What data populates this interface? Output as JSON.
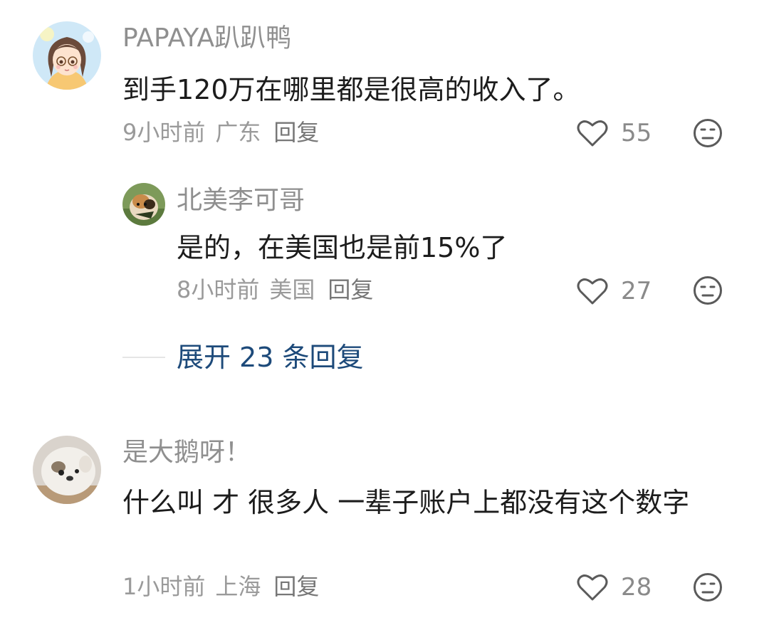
{
  "comments": [
    {
      "username": "PAPAYA趴趴鸭",
      "content": "到手120万在哪里都是很高的收入了。",
      "time": "9小时前",
      "location": "广东",
      "reply_label": "回复",
      "likes": "55",
      "avatar_icon": "anime-girl-avatar",
      "replies": [
        {
          "username": "北美李可哥",
          "content": "是的，在美国也是前15%了",
          "time": "8小时前",
          "location": "美国",
          "reply_label": "回复",
          "likes": "27",
          "avatar_icon": "hamster-avatar"
        }
      ],
      "expand_label": "展开 23 条回复"
    },
    {
      "username": "是大鹅呀！",
      "content": "什么叫 才 很多人 一辈子账户上都没有这个数字",
      "time": "1小时前",
      "location": "上海",
      "reply_label": "回复",
      "likes": "28",
      "avatar_icon": "puppy-avatar"
    }
  ],
  "colors": {
    "username": "#8f8f8f",
    "content": "#1c1c1c",
    "meta": "#9a9a9a",
    "expand": "#1d4a7a"
  }
}
